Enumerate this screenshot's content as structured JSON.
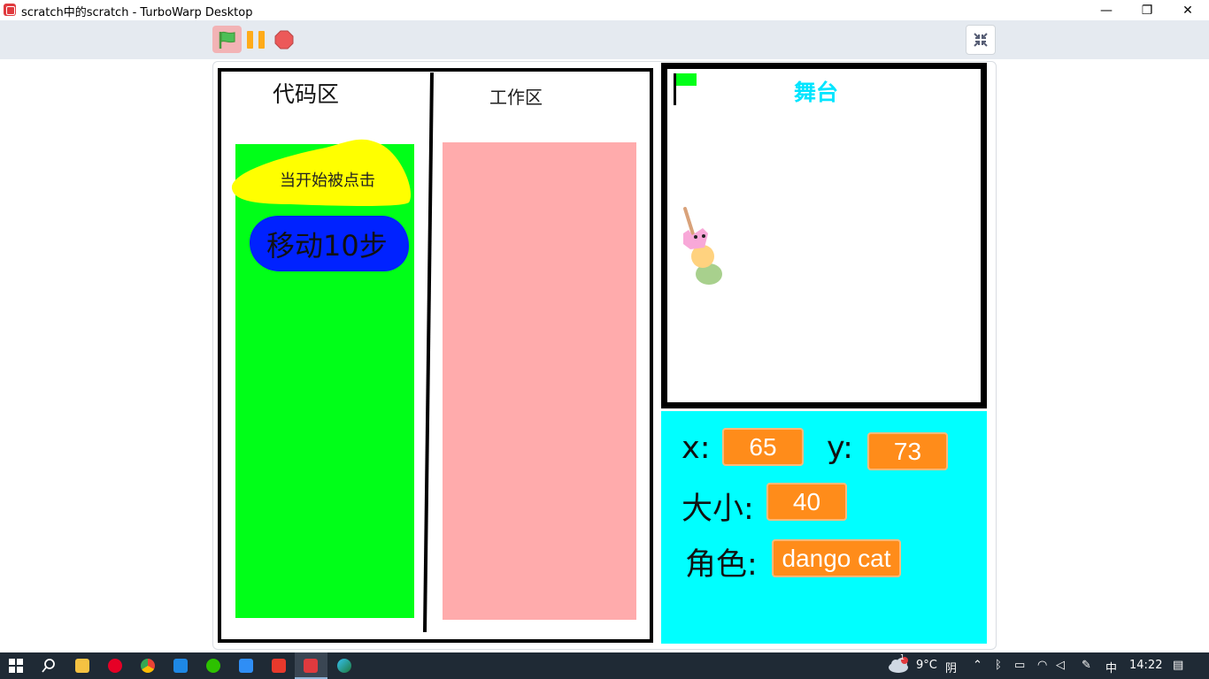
{
  "window": {
    "title": "scratch中的scratch - TurboWarp Desktop",
    "minimize": "—",
    "maximize": "❐",
    "close": "✕"
  },
  "code_panel": {
    "code_area_title": "代码区",
    "work_area_title": "工作区",
    "event_block_label": "当开始被点击",
    "motion_block_label": "移动10步"
  },
  "stage_panel": {
    "title": "舞台"
  },
  "info_panel": {
    "x_label": "x:",
    "x_value": "65",
    "y_label": "y:",
    "y_value": "73",
    "size_label": "大小:",
    "size_value": "40",
    "sprite_label": "角色:",
    "sprite_value": "dango cat"
  },
  "taskbar": {
    "temperature": "9°C",
    "weather": "阴",
    "ime": "中",
    "time": "14:22",
    "notification_count": "1"
  },
  "colors": {
    "toolbar_bg": "#e5eaf0",
    "code_green": "#00ff18",
    "work_pink": "#ffabac",
    "block_yellow": "#ffff00",
    "block_blue": "#0022ff",
    "stage_title": "#00e5ff",
    "info_bg": "#00ffff",
    "value_orange": "#ff8c1a"
  }
}
